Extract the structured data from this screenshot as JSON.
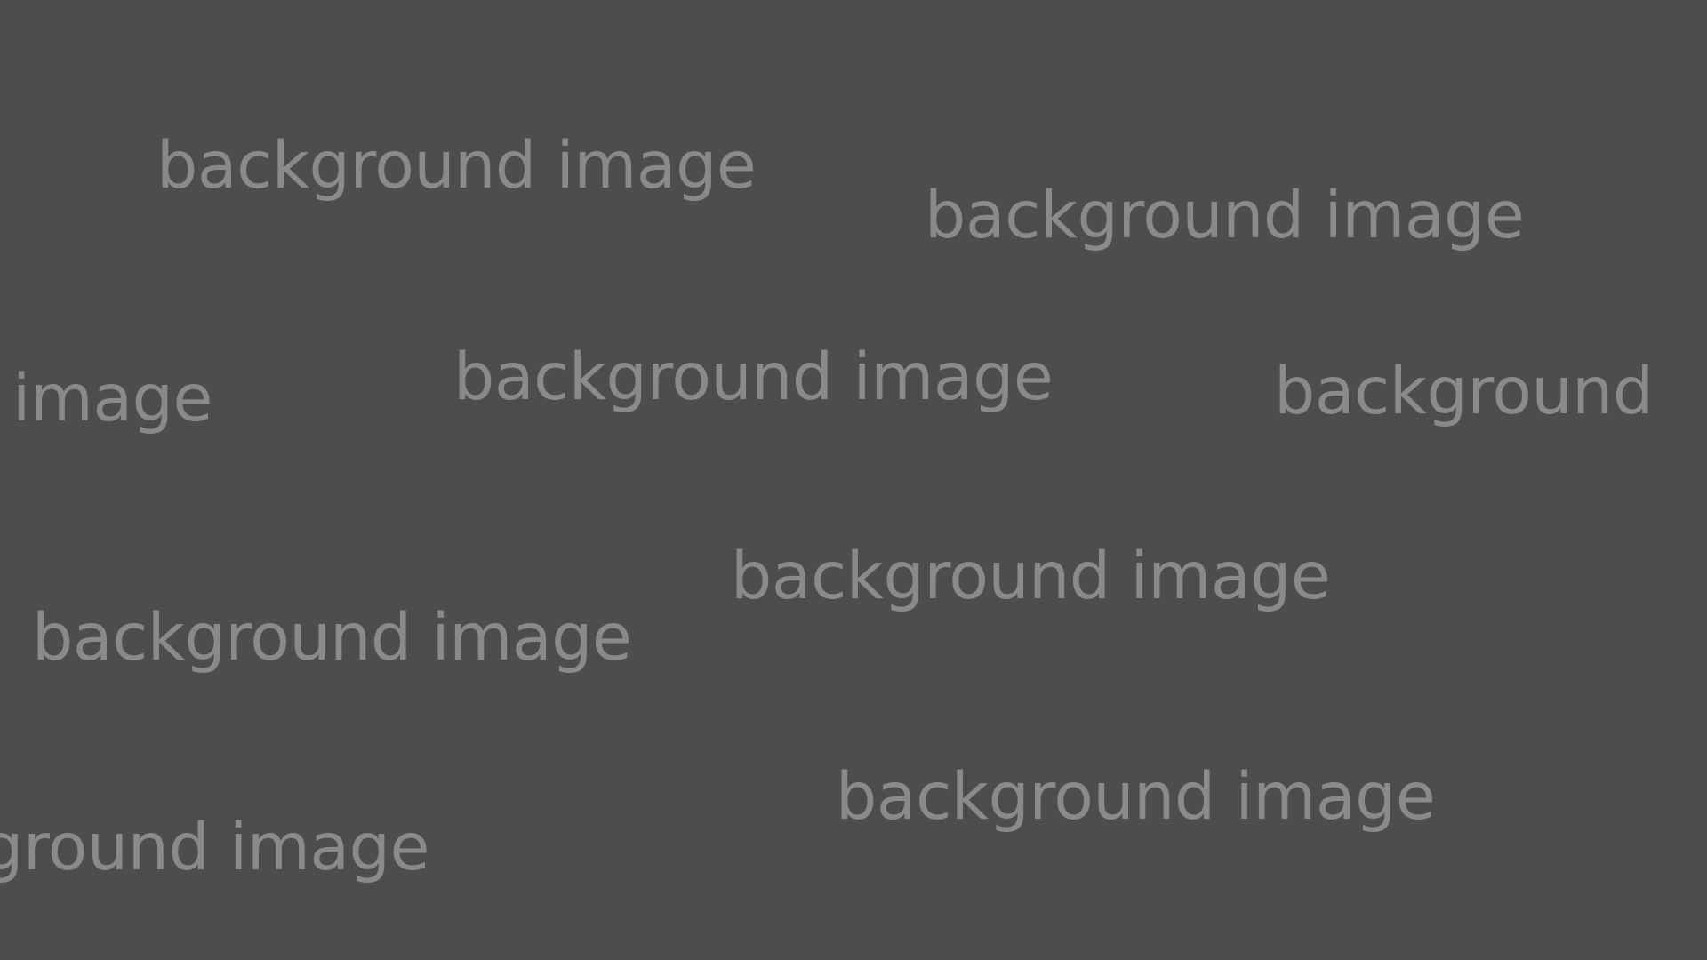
{
  "desktop": {
    "background_color": "#4d4d4d",
    "text_color": "#8a8a8a",
    "labels": [
      "background image",
      "background image",
      "image",
      "background image",
      "background",
      "background image",
      "background image",
      "background image",
      "ground image"
    ]
  }
}
